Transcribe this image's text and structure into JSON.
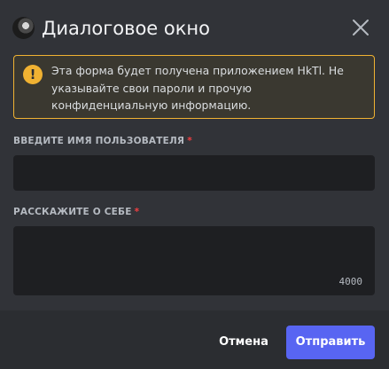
{
  "dialog": {
    "title": "Диалоговое окно",
    "close_icon": "close-icon",
    "avatar_icon": "app-avatar"
  },
  "warning": {
    "icon": "exclamation-icon",
    "text": "Эта форма будет получена приложением HkTl. Не указывайте свои пароли и прочую конфиденциальную информацию.",
    "accent_color": "#f0b232"
  },
  "fields": {
    "username": {
      "label": "Введите имя пользователя",
      "required_mark": "*",
      "value": ""
    },
    "about": {
      "label": "Расскажите о себе",
      "required_mark": "*",
      "value": "",
      "counter": "4000"
    }
  },
  "footer": {
    "cancel_label": "Отмена",
    "submit_label": "Отправить",
    "submit_color": "#5865f2"
  }
}
